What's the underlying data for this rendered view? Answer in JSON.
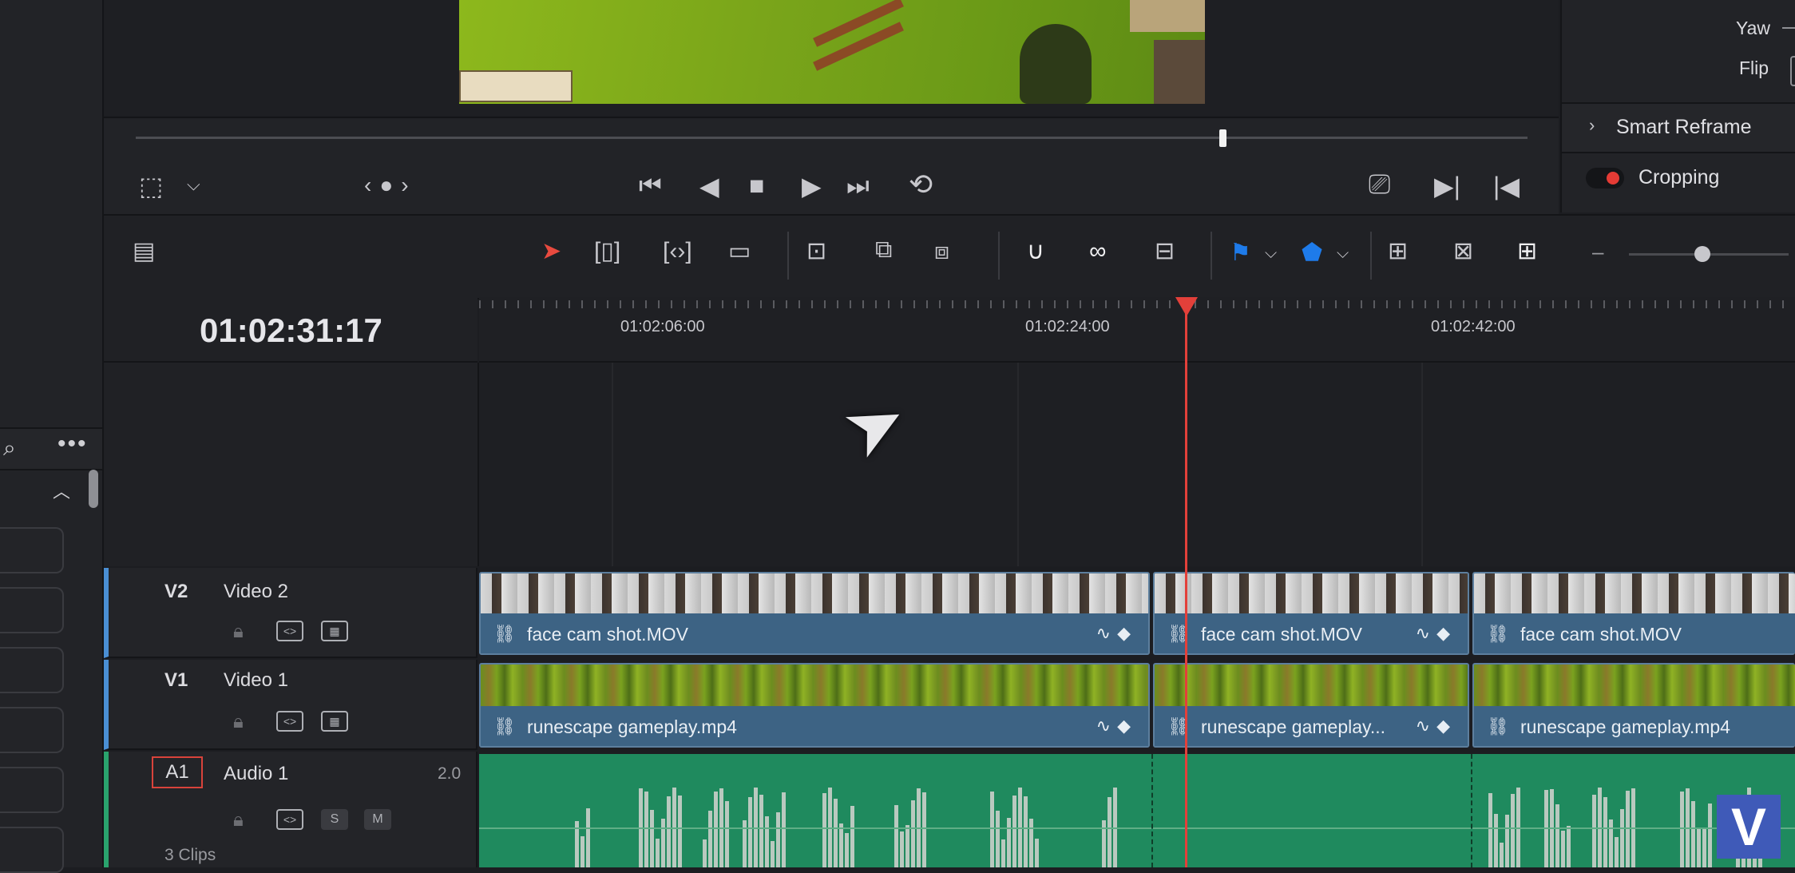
{
  "inspector": {
    "yaw_label": "Yaw",
    "flip_label": "Flip",
    "smart_reframe_label": "Smart Reframe",
    "cropping_label": "Cropping"
  },
  "timeline": {
    "timecode": "01:02:31:17",
    "ruler_labels": [
      "01:02:06:00",
      "01:02:24:00",
      "01:02:42:00"
    ]
  },
  "tracks": [
    {
      "id": "V2",
      "name": "Video 2",
      "clips": [
        "face cam shot.MOV",
        "face cam shot.MOV",
        "face cam shot.MOV"
      ]
    },
    {
      "id": "V1",
      "name": "Video 1",
      "clips": [
        "runescape gameplay.mp4",
        "runescape gameplay...",
        "runescape gameplay.mp4"
      ]
    },
    {
      "id": "A1",
      "name": "Audio 1",
      "channels": "2.0",
      "clip_count": "3 Clips",
      "solo_label": "S",
      "mute_label": "M"
    }
  ],
  "icons": {
    "link": "🔗",
    "logo": "V"
  },
  "colors": {
    "playhead": "#e3403a",
    "video_clip": "#3d6384",
    "audio_clip": "#1f8a5e",
    "flag_blue": "#1e7bea"
  }
}
